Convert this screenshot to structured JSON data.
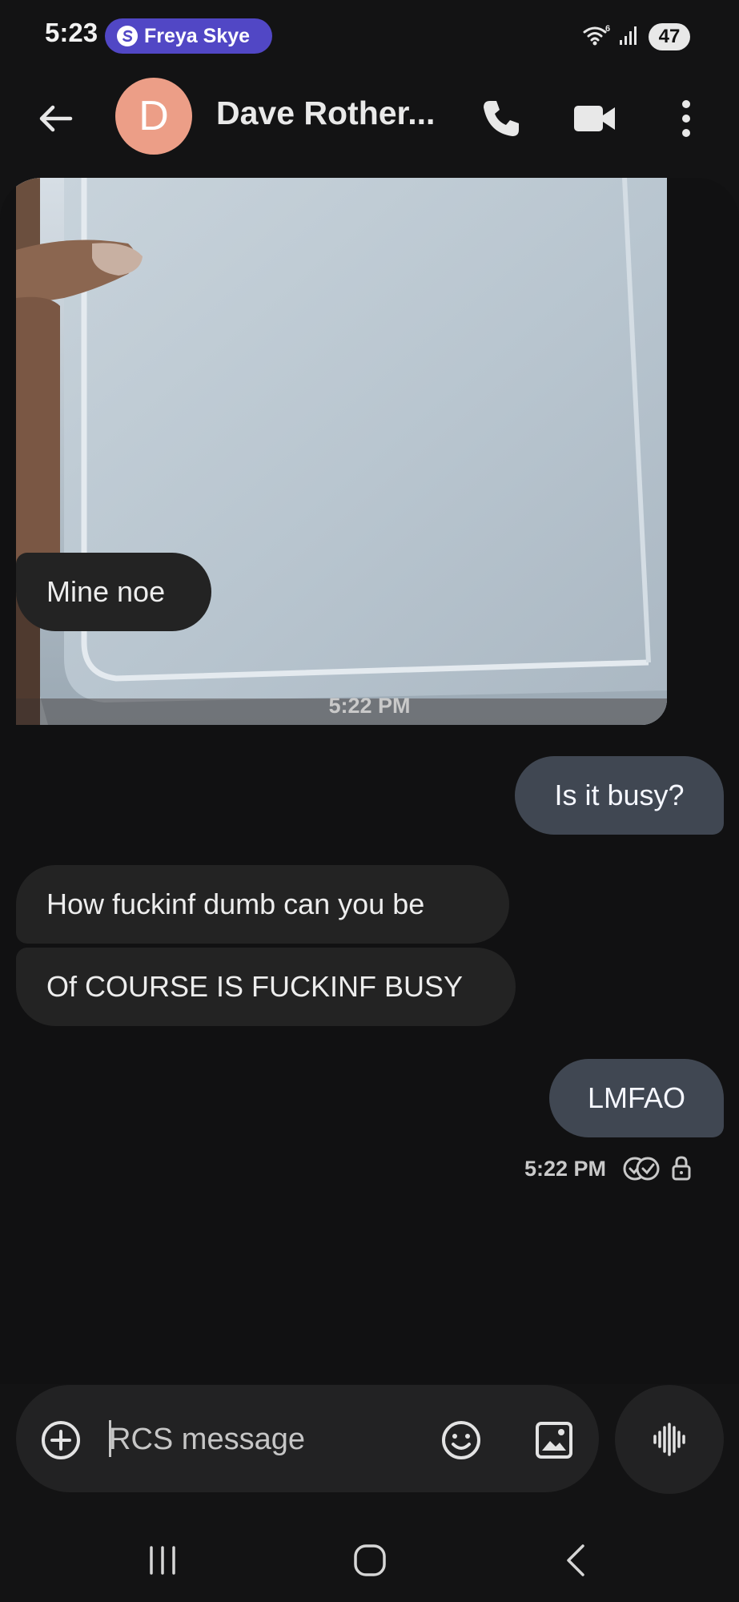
{
  "status_bar": {
    "time": "5:23",
    "notification_pill_text": "Freya Skye",
    "notification_pill_color": "#5147c5",
    "wifi_icon": "wifi-6-icon",
    "signal_icon": "cell-signal-icon",
    "battery_level": "47"
  },
  "header": {
    "avatar_letter": "D",
    "avatar_color": "#ec9e87",
    "contact_name": "Dave Rother...",
    "call_icon": "phone-icon",
    "video_icon": "video-camera-icon",
    "more_icon": "more-vert-icon"
  },
  "conversation": {
    "photo_attachment": "photo-message",
    "messages": [
      {
        "direction": "incoming",
        "text": "Mine noe"
      },
      {
        "type": "timestamp",
        "text": "5:22 PM"
      },
      {
        "direction": "outgoing",
        "text": "Is it busy?"
      },
      {
        "direction": "incoming",
        "text": "How fuckinf dumb can you be"
      },
      {
        "direction": "incoming",
        "text": "Of COURSE IS FUCKINF BUSY"
      },
      {
        "direction": "outgoing",
        "text": "LMFAO"
      }
    ],
    "last_status_time": "5:22 PM",
    "read_icon": "read-receipt-icon",
    "lock_icon": "lock-icon"
  },
  "composer": {
    "placeholder": "RCS message",
    "value": "",
    "add_icon": "add-circle-icon",
    "emoji_icon": "emoji-icon",
    "gallery_icon": "gallery-icon",
    "voice_icon": "voice-waveform-icon"
  },
  "nav_bar": {
    "recent_icon": "recent-apps-icon",
    "home_icon": "home-icon",
    "back_icon": "back-icon"
  },
  "colors": {
    "background": "#131314",
    "incoming_bubble": "#232323",
    "outgoing_bubble": "#404752",
    "composer": "#222223"
  }
}
